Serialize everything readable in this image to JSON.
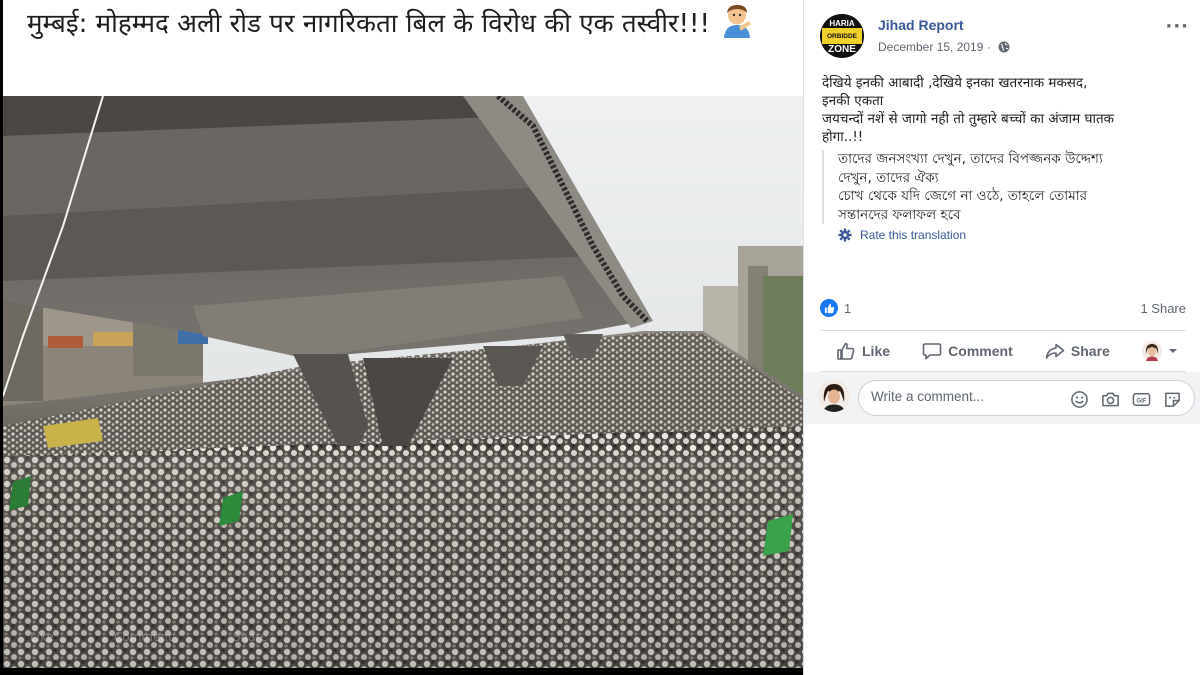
{
  "photo": {
    "caption": "मुम्बई: मोहम्मद अली रोड पर नागरिकता बिल के विरोध की एक तस्वीर!!!",
    "faded_actions": [
      "Like",
      "Comment",
      "Share"
    ]
  },
  "post": {
    "page_name": "Jihad Report",
    "avatar_text": [
      "HARIA",
      "ORBIDDE",
      "ZONE"
    ],
    "date": "December 15, 2019",
    "privacy_icon": "globe-icon",
    "more_icon": "···",
    "body_lines": [
      "देखिये इनकी आबादी ,देखिये इनका खतरनाक मकसद,",
      "इनकी एकता",
      "जयचन्दों नशें से जागो नही तो तुम्हारे बच्चों का अंजाम घातक",
      "होगा..!!"
    ],
    "translation_lines": [
      "তাদের জনসংখ্যা দেখুন, তাদের বিপজ্জনক উদ্দেশ্য",
      "দেখুন, তাদের ঐক্য",
      "চোখ থেকে যদি জেগে না ওঠে, তাহলে তোমার",
      "সন্তানদের ফলাফল হবে"
    ],
    "rate_translation": "Rate this translation",
    "reaction_count": "1",
    "share_count": "1 Share",
    "actions": {
      "like": "Like",
      "comment": "Comment",
      "share": "Share"
    },
    "comment_placeholder": "Write a comment..."
  },
  "colors": {
    "link_blue": "#385898",
    "facebook_blue": "#1877f2",
    "muted_text": "#606770"
  }
}
